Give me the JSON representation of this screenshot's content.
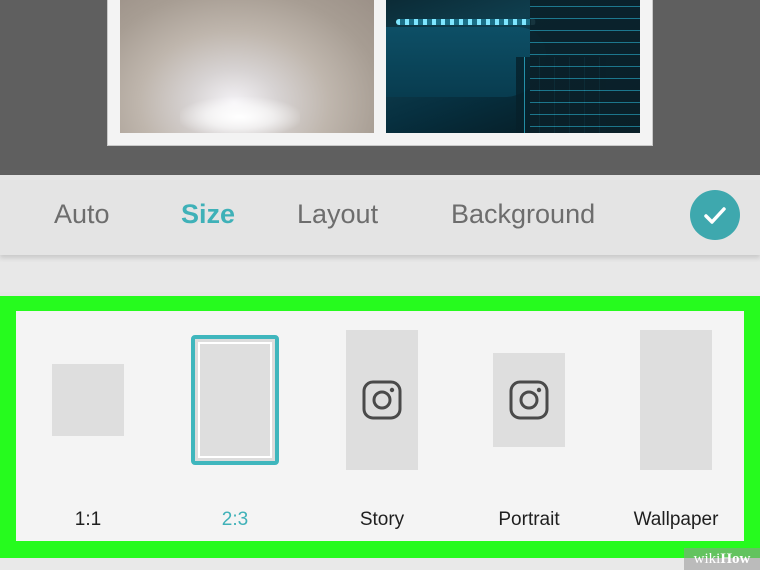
{
  "tabs": [
    {
      "label": "Auto",
      "active": false
    },
    {
      "label": "Size",
      "active": true
    },
    {
      "label": "Layout",
      "active": false
    },
    {
      "label": "Background",
      "active": false
    }
  ],
  "confirm_icon": "checkmark-icon",
  "size_options": [
    {
      "label": "1:1",
      "selected": false,
      "icon": ""
    },
    {
      "label": "2:3",
      "selected": true,
      "icon": ""
    },
    {
      "label": "Story",
      "selected": false,
      "icon": "instagram-icon"
    },
    {
      "label": "Portrait",
      "selected": false,
      "icon": "instagram-icon"
    },
    {
      "label": "Wallpaper",
      "selected": false,
      "icon": ""
    }
  ],
  "watermark": {
    "prefix": "wiki",
    "brand": "How"
  },
  "colors": {
    "accent": "#3fb1b8",
    "highlight": "#26fb1e",
    "confirm": "#3ea8ae"
  }
}
